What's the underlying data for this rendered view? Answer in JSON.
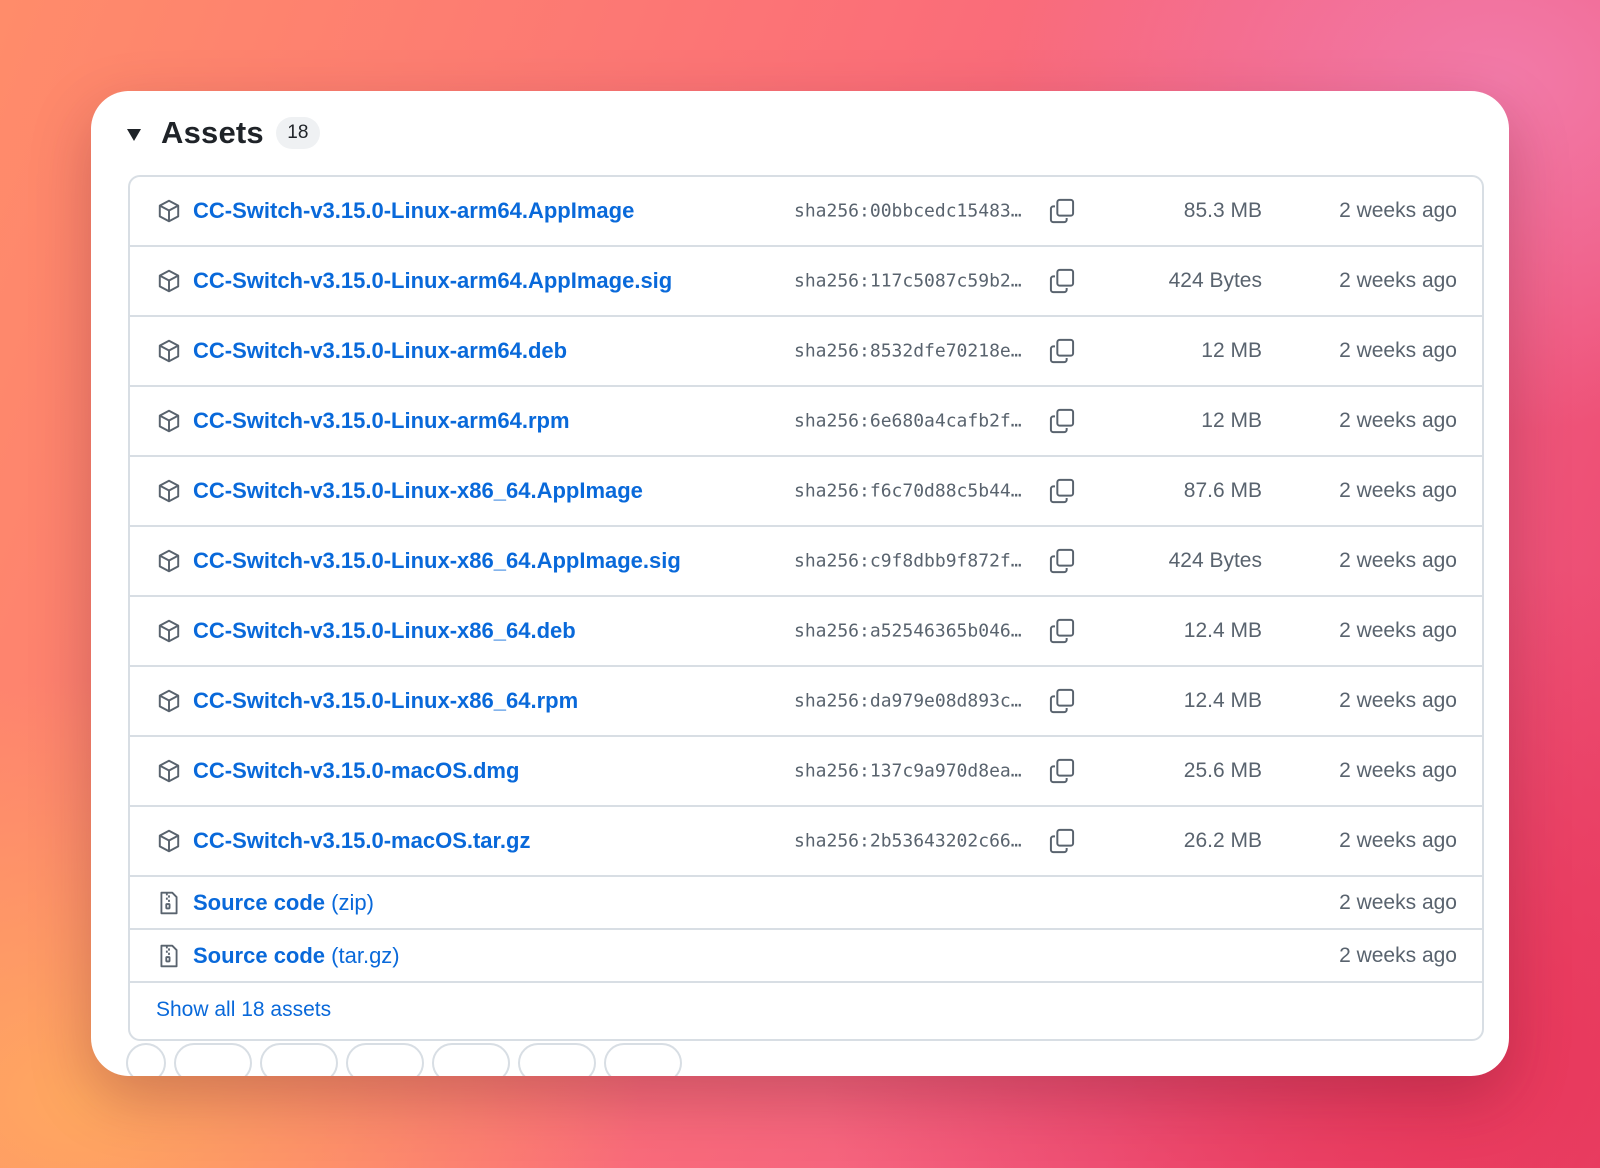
{
  "assets": {
    "title": "Assets",
    "count": "18",
    "items": [
      {
        "name": "CC-Switch-v3.15.0-Linux-arm64.AppImage",
        "hash": "sha256:00bbcedc15483…",
        "size": "85.3 MB",
        "date": "2 weeks ago"
      },
      {
        "name": "CC-Switch-v3.15.0-Linux-arm64.AppImage.sig",
        "hash": "sha256:117c5087c59b2…",
        "size": "424 Bytes",
        "date": "2 weeks ago"
      },
      {
        "name": "CC-Switch-v3.15.0-Linux-arm64.deb",
        "hash": "sha256:8532dfe70218e…",
        "size": "12 MB",
        "date": "2 weeks ago"
      },
      {
        "name": "CC-Switch-v3.15.0-Linux-arm64.rpm",
        "hash": "sha256:6e680a4cafb2f…",
        "size": "12 MB",
        "date": "2 weeks ago"
      },
      {
        "name": "CC-Switch-v3.15.0-Linux-x86_64.AppImage",
        "hash": "sha256:f6c70d88c5b44…",
        "size": "87.6 MB",
        "date": "2 weeks ago"
      },
      {
        "name": "CC-Switch-v3.15.0-Linux-x86_64.AppImage.sig",
        "hash": "sha256:c9f8dbb9f872f…",
        "size": "424 Bytes",
        "date": "2 weeks ago"
      },
      {
        "name": "CC-Switch-v3.15.0-Linux-x86_64.deb",
        "hash": "sha256:a52546365b046…",
        "size": "12.4 MB",
        "date": "2 weeks ago"
      },
      {
        "name": "CC-Switch-v3.15.0-Linux-x86_64.rpm",
        "hash": "sha256:da979e08d893c…",
        "size": "12.4 MB",
        "date": "2 weeks ago"
      },
      {
        "name": "CC-Switch-v3.15.0-macOS.dmg",
        "hash": "sha256:137c9a970d8ea…",
        "size": "25.6 MB",
        "date": "2 weeks ago"
      },
      {
        "name": "CC-Switch-v3.15.0-macOS.tar.gz",
        "hash": "sha256:2b53643202c66…",
        "size": "26.2 MB",
        "date": "2 weeks ago"
      }
    ],
    "source": [
      {
        "label": "Source code",
        "format": "(zip)",
        "date": "2 weeks ago"
      },
      {
        "label": "Source code",
        "format": "(tar.gz)",
        "date": "2 weeks ago"
      }
    ],
    "show_all": "Show all 18 assets"
  },
  "icons": {
    "package": "package-icon",
    "copy": "copy-icon",
    "archive": "file-zip-icon",
    "caret": "triangle-down-icon"
  },
  "colors": {
    "link": "#0969da",
    "muted": "#59636e",
    "border": "#d8dee4",
    "text": "#1f2328"
  }
}
